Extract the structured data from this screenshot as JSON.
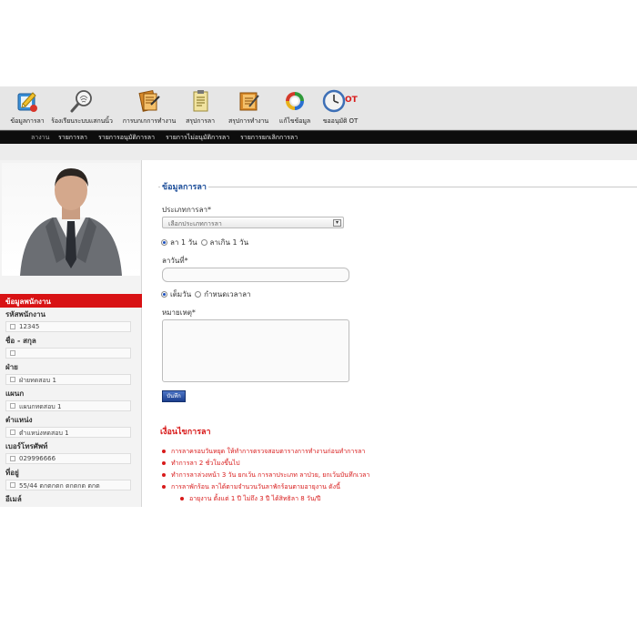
{
  "toolbar": {
    "items": [
      {
        "label": "ข้อมูลการลา",
        "icon": "leave-info-icon"
      },
      {
        "label": "ร้องเรียนระบบแสกนนิ้ว",
        "icon": "fingerprint-scan-icon"
      },
      {
        "label": "การบกเกการทำงาน",
        "icon": "work-record-icon"
      },
      {
        "label": "สรุปการลา",
        "icon": "leave-summary-icon"
      },
      {
        "label": "สรุปการทำงาน",
        "icon": "work-summary-icon"
      },
      {
        "label": "แก้ไขข้อมูล",
        "icon": "edit-data-icon"
      },
      {
        "label": "ขออนุมัติ OT",
        "icon": "ot-clock-icon"
      }
    ]
  },
  "nav": {
    "items": [
      "ลางาน",
      "รายการลา",
      "รายการอนุมัติการลา",
      "รายการไม่อนุมัติการลา",
      "รายการยกเลิกการลา"
    ]
  },
  "sidebar": {
    "section_title": "ข้อมูลพนักงาน",
    "fields": [
      {
        "label": "รหัสพนักงาน",
        "value": "12345"
      },
      {
        "label": "ชื่อ - สกุล",
        "value": ""
      },
      {
        "label": "ฝ่าย",
        "value": "ฝ่ายทดสอบ 1"
      },
      {
        "label": "แผนก",
        "value": "แผนกทดสอบ 1"
      },
      {
        "label": "ตำแหน่ง",
        "value": "ตำแหน่งทดสอบ 1"
      },
      {
        "label": "เบอร์โทรศัพท์",
        "value": "029996666"
      },
      {
        "label": "ที่อยู่",
        "value": "55/44 ตกตกตก ตกตกต ตกต"
      },
      {
        "label": "อีเมล์",
        "value": ""
      }
    ]
  },
  "form": {
    "legend": "ข้อมูลการลา",
    "leave_type_label": "ประเภทการลา*",
    "leave_type_value": "เลือกประเภทการลา",
    "duration_option_1": "ลา 1 วัน",
    "duration_option_2": "ลาเกิน 1 วัน",
    "date_label": "ลาวันที่*",
    "period_option_1": "เต็มวัน",
    "period_option_2": "กำหนดเวลาลา",
    "note_label": "หมายเหตุ*",
    "submit_label": "บันทึก"
  },
  "conditions": {
    "title": "เงื่อนไขการลา",
    "items": [
      "การลาครอบวันหยุด ให้ทำการตรวจสอบตารางการทำงานก่อนทำการลา",
      "ทำการลา 2 ชั่วโมงขึ้นไป",
      "ทำการลาล่วงหน้า 3 วัน ยกเว้น การลาประเภท ลาป่วย, ยกเว้นบันทึกเวลา",
      "การลาพักร้อน ลาได้ตามจำนวนวันลาพักร้อนตามอายุงาน ดังนี้"
    ],
    "sub_items": [
      "อายุงาน ตั้งแต่ 1 ปี ไม่ถึง 3 ปี ได้สิทธิลา 8 วัน/ปี"
    ]
  },
  "colors": {
    "accent_red": "#d81a1a",
    "legend_blue": "#1e4f9a",
    "nav_black": "#0d0d0d"
  }
}
